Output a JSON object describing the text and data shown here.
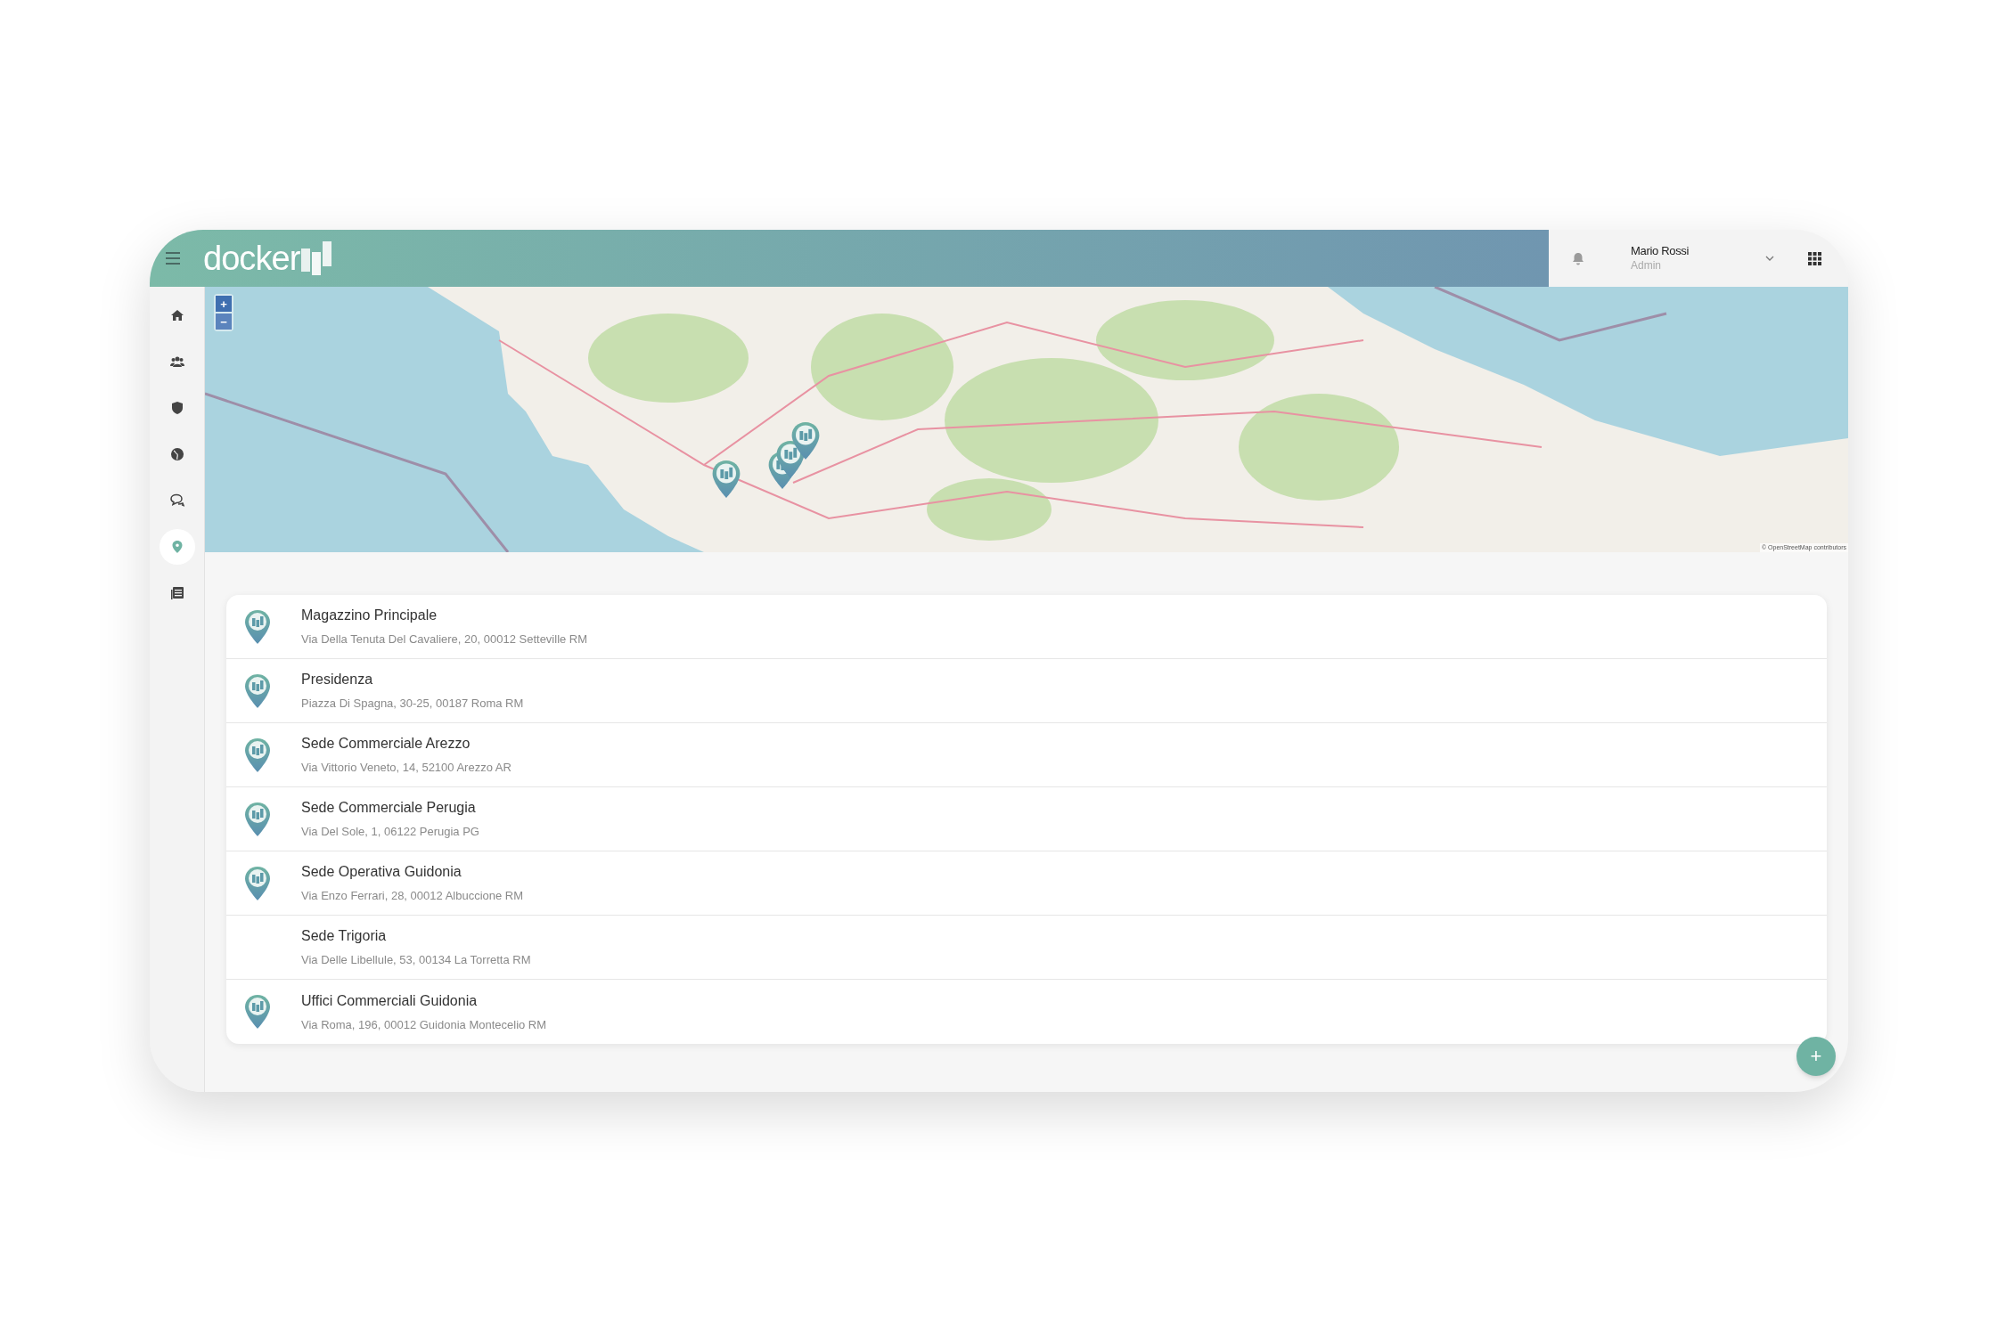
{
  "header": {
    "logo": "docker",
    "user": {
      "name": "Mario Rossi",
      "role": "Admin"
    }
  },
  "sidebar": {
    "items": [
      {
        "selected": false
      },
      {
        "selected": false
      },
      {
        "selected": false
      },
      {
        "selected": false
      },
      {
        "selected": false
      },
      {
        "selected": true
      },
      {
        "selected": false
      }
    ]
  },
  "map": {
    "zoom_in": "+",
    "zoom_out": "−",
    "attribution": "© OpenStreetMap contributors"
  },
  "locations": [
    {
      "name": "Magazzino Principale",
      "address": "Via Della Tenuta Del Cavaliere, 20, 00012 Setteville RM",
      "pinned": true
    },
    {
      "name": "Presidenza",
      "address": "Piazza Di Spagna, 30-25, 00187 Roma RM",
      "pinned": true
    },
    {
      "name": "Sede Commerciale Arezzo",
      "address": "Via Vittorio Veneto, 14, 52100 Arezzo AR",
      "pinned": true
    },
    {
      "name": "Sede Commerciale Perugia",
      "address": "Via Del Sole, 1, 06122 Perugia PG",
      "pinned": true
    },
    {
      "name": "Sede Operativa Guidonia",
      "address": "Via Enzo Ferrari, 28, 00012 Albuccione RM",
      "pinned": true
    },
    {
      "name": "Sede Trigoria",
      "address": "Via Delle Libellule, 53, 00134 La Torretta RM",
      "pinned": false
    },
    {
      "name": "Uffici Commerciali Guidonia",
      "address": "Via Roma, 196, 00012 Guidonia Montecelio RM",
      "pinned": true
    }
  ],
  "add_button": "+"
}
